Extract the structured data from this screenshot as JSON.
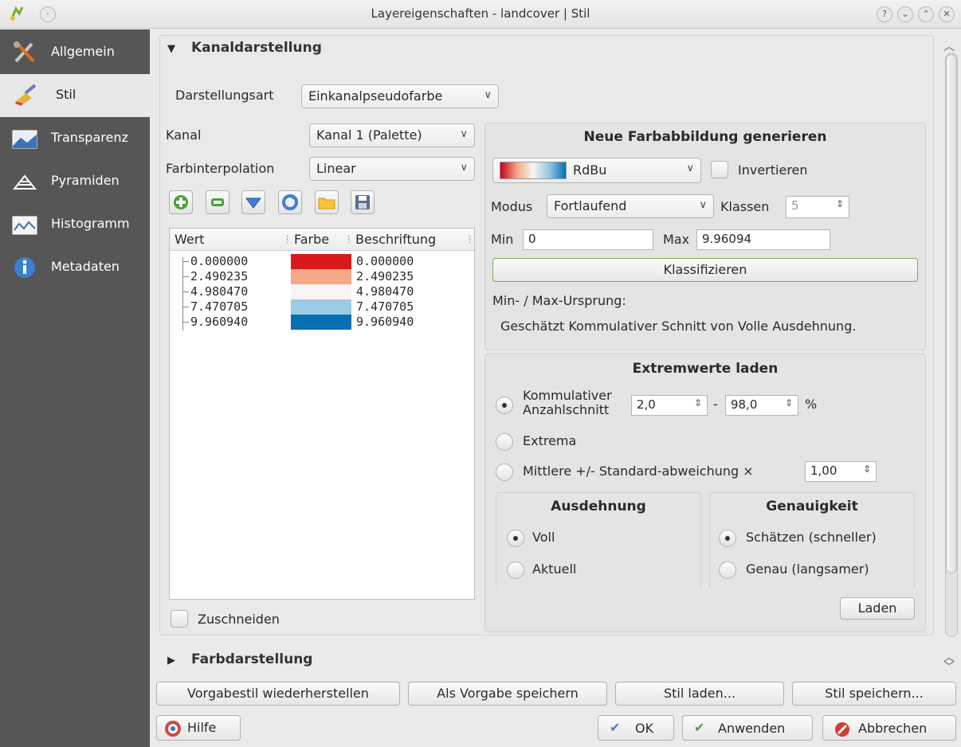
{
  "window": {
    "title": "Layereigenschaften - landcover | Stil"
  },
  "sidebar": {
    "items": [
      {
        "label": "Allgemein",
        "icon": "tools-icon"
      },
      {
        "label": "Stil",
        "icon": "paintbrush-icon"
      },
      {
        "label": "Transparenz",
        "icon": "transparency-icon"
      },
      {
        "label": "Pyramiden",
        "icon": "pyramid-icon"
      },
      {
        "label": "Histogramm",
        "icon": "histogram-icon"
      },
      {
        "label": "Metadaten",
        "icon": "info-icon"
      }
    ],
    "active_index": 1
  },
  "band_section": {
    "title": "Kanaldarstellung",
    "render_type_label": "Darstellungsart",
    "render_type_value": "Einkanalpseudofarbe",
    "band_label": "Kanal",
    "band_value": "Kanal 1 (Palette)",
    "interp_label": "Farbinterpolation",
    "interp_value": "Linear",
    "table": {
      "headers": [
        "Wert",
        "Farbe",
        "Beschriftung"
      ],
      "rows": [
        {
          "value": "0.000000",
          "color": "#d7191c",
          "label": "0.000000"
        },
        {
          "value": "2.490235",
          "color": "#f5a887",
          "label": "2.490235"
        },
        {
          "value": "4.980470",
          "color": "#f8f4f3",
          "label": "4.980470"
        },
        {
          "value": "7.470705",
          "color": "#9ccbe6",
          "label": "7.470705"
        },
        {
          "value": "9.960940",
          "color": "#0a6fb2",
          "label": "9.960940"
        }
      ]
    },
    "clip_label": "Zuschneiden"
  },
  "colormap": {
    "title": "Neue Farbabbildung generieren",
    "ramp_value": "RdBu",
    "invert_label": "Invertieren",
    "mode_label": "Modus",
    "mode_value": "Fortlaufend",
    "classes_label": "Klassen",
    "classes_value": "5",
    "min_label": "Min",
    "min_value": "0",
    "max_label": "Max",
    "max_value": "9.96094",
    "classify_label": "Klassifizieren",
    "origin_label": "Min- / Max-Ursprung:",
    "origin_value": "Geschätzt Kommulativer Schnitt von Volle Ausdehnung."
  },
  "extremes": {
    "title": "Extremwerte laden",
    "cumulative_label": "Kommulativer Anzahlschnitt",
    "cumulative_line1": "Kommulativer",
    "cumulative_line2": "Anzahlschnitt",
    "cum_low": "2,0",
    "cum_dash": "-",
    "cum_high": "98,0",
    "cum_unit": "%",
    "extrema_label": "Extrema",
    "stddev_label": "Mittlere +/- Standard-abweichung ×",
    "stddev_value": "1,00",
    "extent_title": "Ausdehnung",
    "extent_full": "Voll",
    "extent_current": "Aktuell",
    "accuracy_title": "Genauigkeit",
    "accuracy_estimate": "Schätzen (schneller)",
    "accuracy_exact": "Genau (langsamer)",
    "load_label": "Laden"
  },
  "color_section": {
    "title": "Farbdarstellung"
  },
  "bottom": {
    "restore_default": "Vorgabestil wiederherstellen",
    "save_default": "Als Vorgabe speichern",
    "load_style": "Stil laden...",
    "save_style": "Stil speichern...",
    "help": "Hilfe",
    "ok": "OK",
    "apply": "Anwenden",
    "cancel": "Abbrechen"
  }
}
